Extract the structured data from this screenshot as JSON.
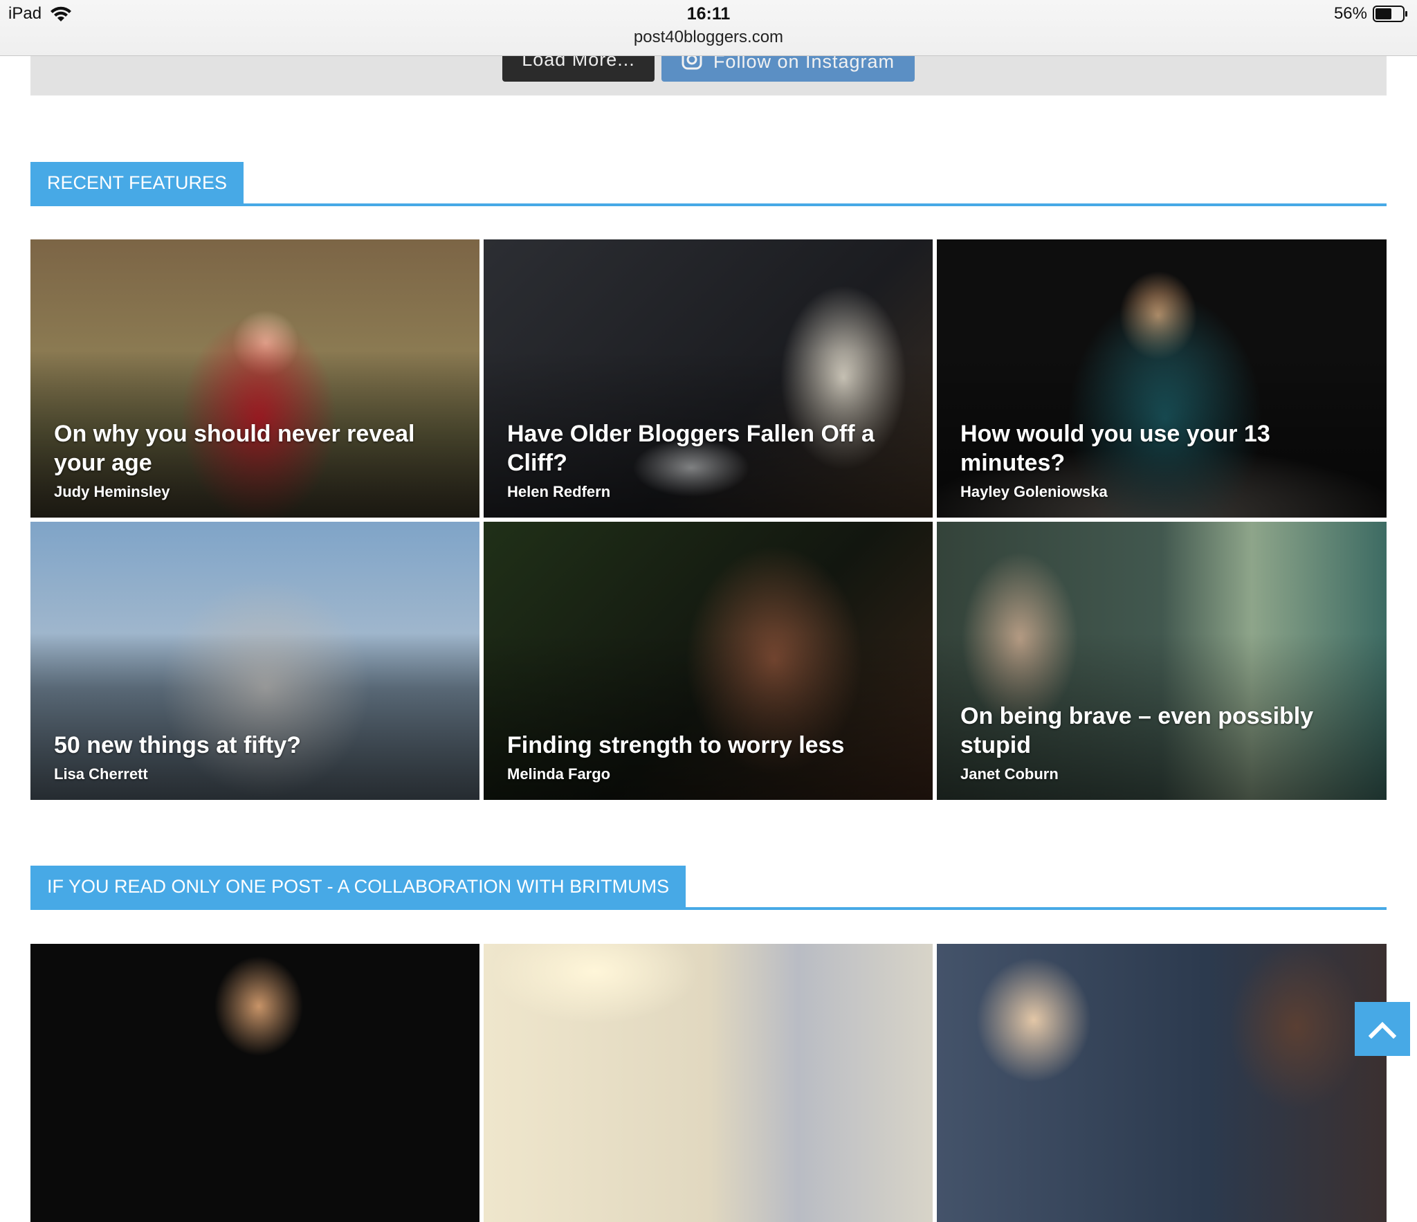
{
  "status_bar": {
    "device": "iPad",
    "time": "16:11",
    "url": "post40bloggers.com",
    "battery": "56%"
  },
  "top_buttons": {
    "load_more": "Load More...",
    "follow": "Follow on Instagram"
  },
  "sections": {
    "recent": {
      "title": "RECENT FEATURES"
    },
    "one_post": {
      "title": "IF YOU READ ONLY ONE POST - A COLLABORATION WITH BRITMUMS"
    }
  },
  "recent_features": [
    {
      "title": "On why you should never reveal your age",
      "author": "Judy Heminsley"
    },
    {
      "title": "Have Older Bloggers Fallen Off a Cliff?",
      "author": "Helen Redfern"
    },
    {
      "title": "How would you use your 13 minutes?",
      "author": "Hayley Goleniowska"
    },
    {
      "title": "50 new things at fifty?",
      "author": "Lisa Cherrett"
    },
    {
      "title": "Finding strength to worry less",
      "author": "Melinda Fargo"
    },
    {
      "title": "On being brave – even possibly stupid",
      "author": "Janet Coburn"
    }
  ],
  "colors": {
    "accent": "#47a9e6",
    "load_button": "#2b2b2b",
    "instagram_button": "#5b8fc4"
  }
}
